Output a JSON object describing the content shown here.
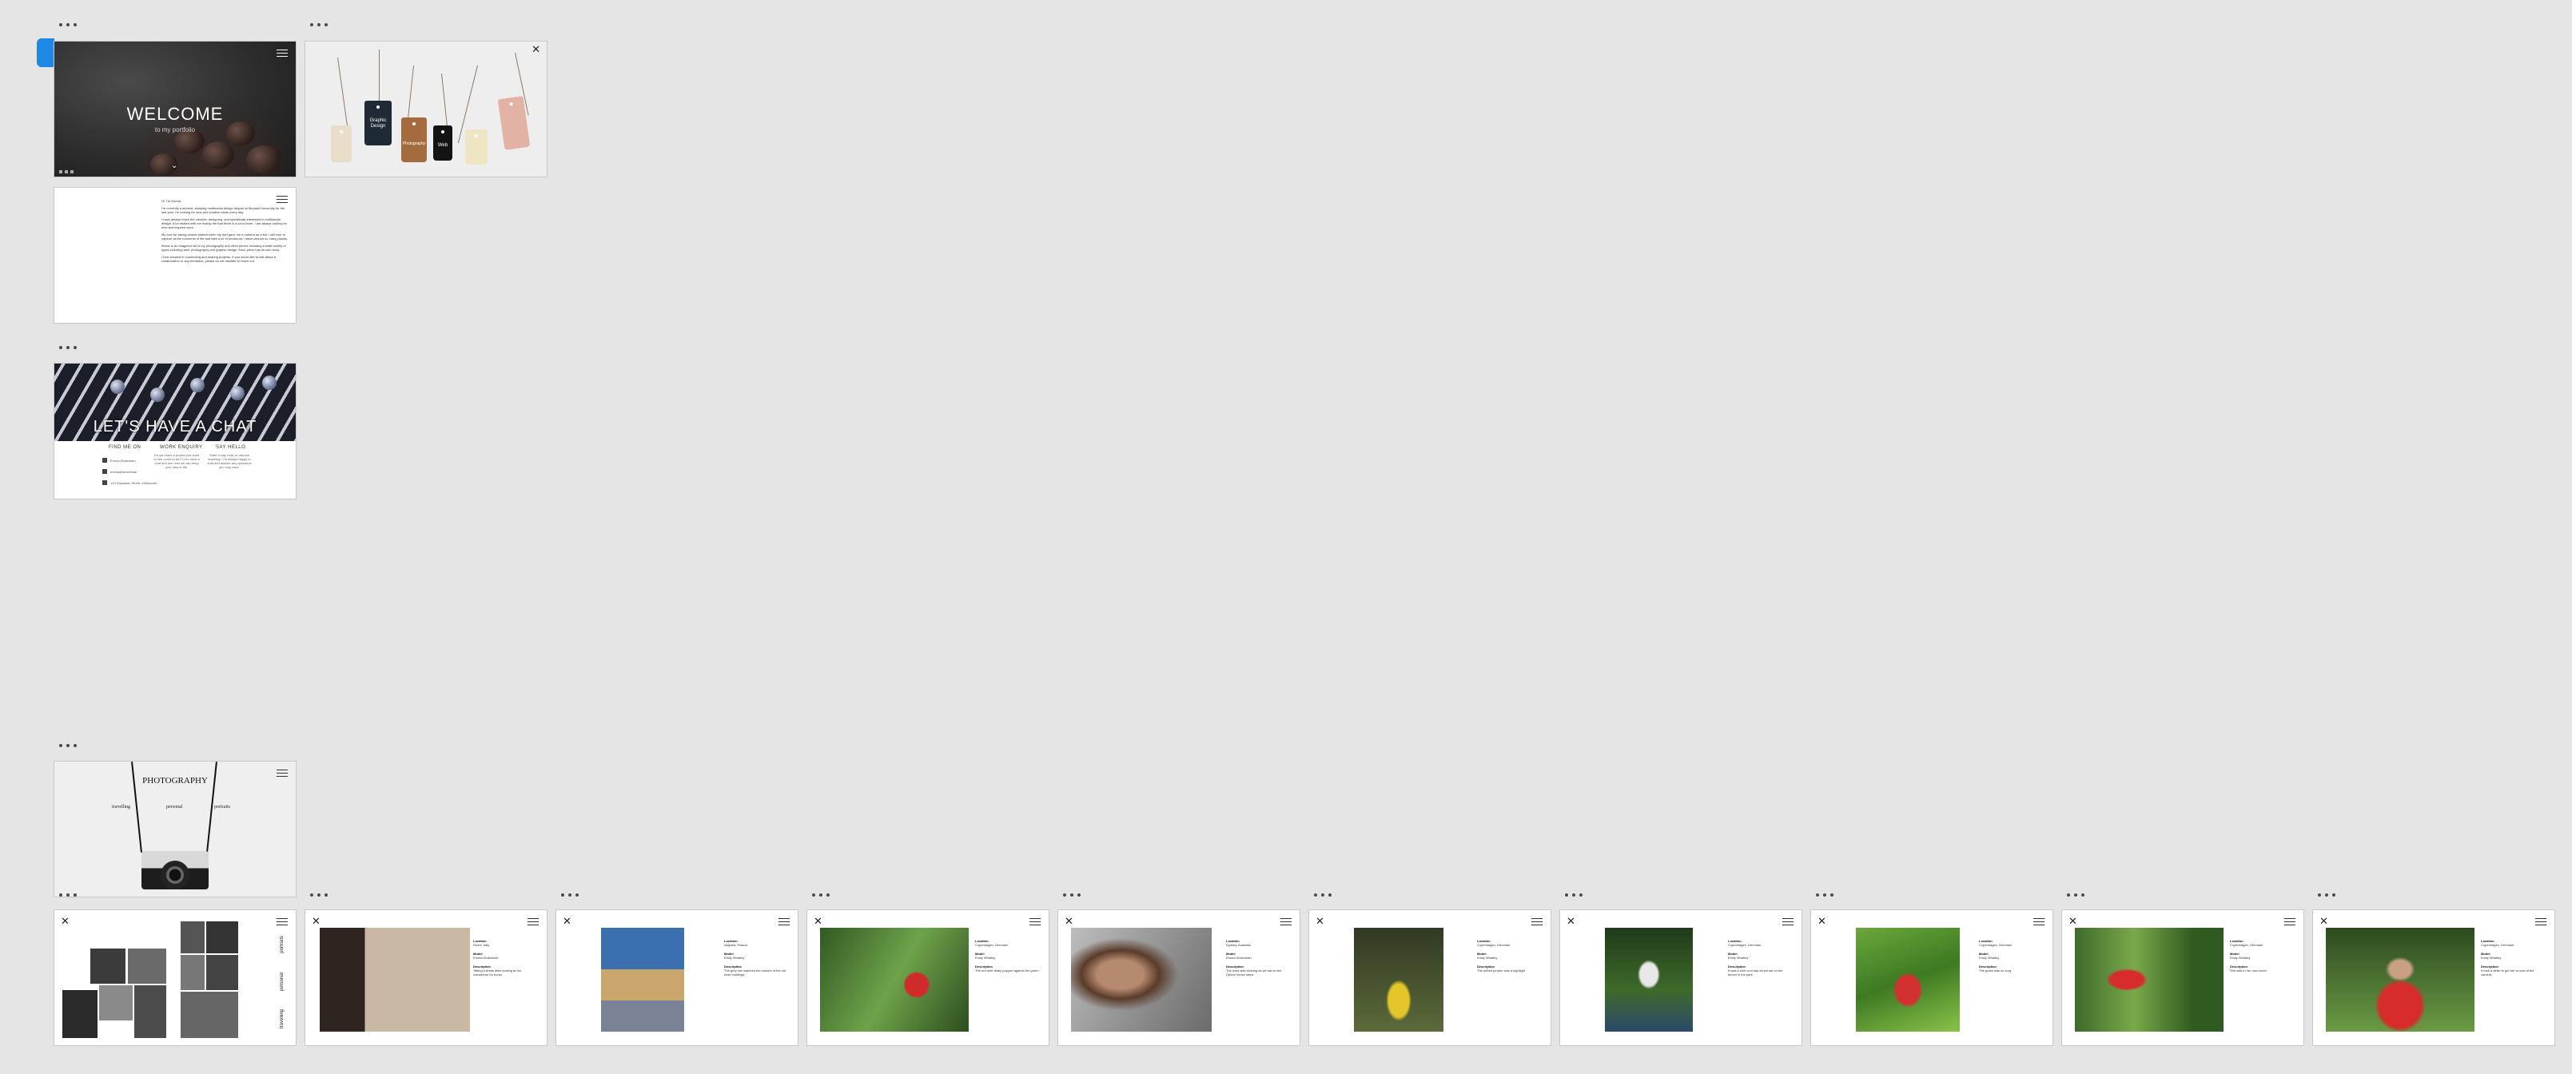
{
  "frames": {
    "welcome": {
      "title": "WELCOME",
      "subtitle": "to my portfolio"
    },
    "tags": {
      "labels": [
        "Graphic Design",
        "Photography",
        "Web"
      ]
    },
    "letter": {
      "greeting": "Hi, I'm Emma",
      "paragraphs": [
        "I'm currently a student, studying multimedia design degree at Monash University for the last year. I'm looking for new and creative ideas every day.",
        "I have always loved the creative, designing, and specifically interested in multimedia design. A lot related with me mainly the that there is a lot to learn. I am always looking for new and inspired work.",
        "My love for taking photos started when my dad gave me a camera as a kid. I still love to capture all the moments of life and take a lot of photos as I travel around so many places.",
        "Below is an imagined list of my photography and other pieces including a wide variety of types including web, photography and graphic design. Each piece has its own story.",
        "I look forward to connecting and sharing projects. If you would like to talk about a collaboration or any feedback, please do not hesitate to reach out."
      ]
    },
    "contact": {
      "title": "LET'S HAVE A CHAT",
      "columns": [
        {
          "head": "FIND ME ON",
          "items": [
            "Emma Dinkelman",
            "emma@dinkelman",
            "123 Swanston Street, Melbourne"
          ]
        },
        {
          "head": "WORK ENQUIRY",
          "text": "Do you have a project you want to see come to life? Let's have a chat and see how we can bring your idea to life."
        },
        {
          "head": "SAY HELLO",
          "text": "Want to say hello or discuss anything? I'm always happy to chat and answer any questions you may have."
        }
      ]
    },
    "photography": {
      "title": "PHOTOGRAPHY",
      "links": [
        "travelling",
        "personal",
        "portraits"
      ]
    },
    "collage": {
      "labels": [
        "portraits",
        "personal",
        "travelling"
      ]
    },
    "details": [
      {
        "location": "Rome, Italy",
        "model": "Emma Dinkelman",
        "description": "Taking a break after looking at the colosseum for hours"
      },
      {
        "location": "Alajuela, Poland",
        "model": "Emily Whatley",
        "description": "The grey hat matched the colours of the old town buildings"
      },
      {
        "location": "Copenhagen, Denmark",
        "model": "Emily Whatley",
        "description": "The red shirt really popped against the green"
      },
      {
        "location": "Sydney, Australia",
        "model": "Emma Dinkelman",
        "description": "The wind was blowing as we sat on the Opera House steps"
      },
      {
        "location": "Copenhagen, Denmark",
        "model": "Emily Whatley",
        "description": "The yellow jumper was a highlight"
      },
      {
        "location": "Copenhagen, Denmark",
        "model": "Emily Whatley",
        "description": "It was a nice cool day as we sat on the bench in the park"
      },
      {
        "location": "Copenhagen, Denmark",
        "model": "Emily Whatley",
        "description": "The grass was so long"
      },
      {
        "location": "Copenhagen, Denmark",
        "model": "Emily Whatley",
        "description": "She was in her own world"
      },
      {
        "location": "Copenhagen, Denmark",
        "model": "Emily Whatley",
        "description": "It took a while to get her to look at the camera"
      }
    ],
    "detail_keys": {
      "location": "Location",
      "model": "Model",
      "description": "Description"
    }
  },
  "colors": {
    "canvas": "#e5e5e5",
    "selection": "#1e88e5"
  }
}
